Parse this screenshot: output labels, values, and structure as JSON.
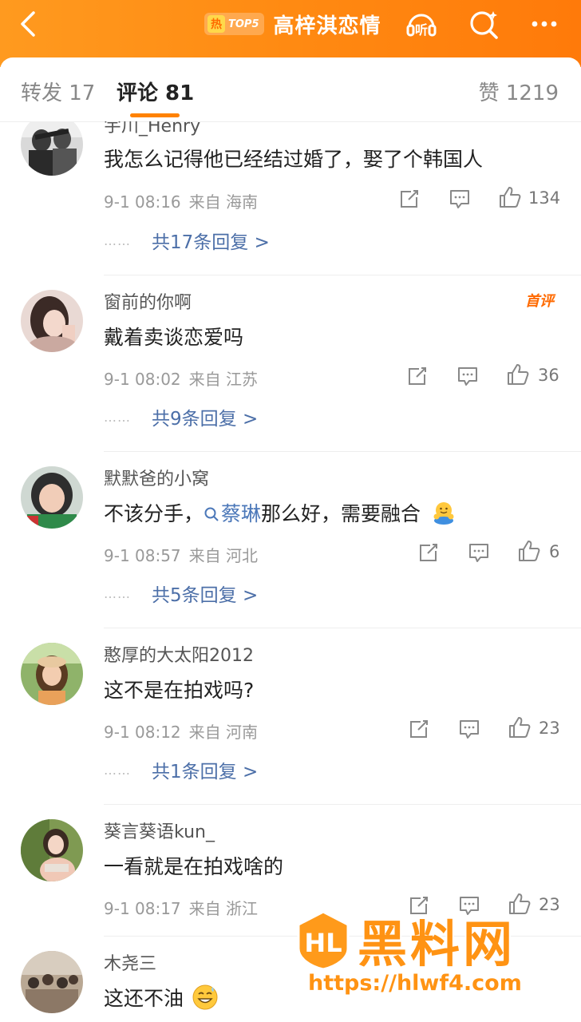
{
  "colors": {
    "accent": "#ff8200",
    "link": "#4c6fa8",
    "topbar_start": "#ff9a1f",
    "topbar_end": "#ff7a0a",
    "first_badge": "#ff6a00"
  },
  "header": {
    "hot_label": "热",
    "rank_label": "TOP5",
    "topic_title": "高梓淇恋情",
    "listen_icon_text": "听",
    "icons": [
      "back-icon",
      "listen-icon",
      "refresh-search-icon",
      "more-icon"
    ]
  },
  "tabs": {
    "repost": "转发 17",
    "comments": "评论 81",
    "likes": "赞 1219",
    "active": "comments"
  },
  "comments": [
    {
      "username": "宇川_Henry",
      "text": "我怎么记得他已经结过婚了，娶了个韩国人",
      "time": "9-1 08:16",
      "source": "来自 海南",
      "likes": "134",
      "replies": "共17条回复 >"
    },
    {
      "username": "窗前的你啊",
      "badge": "首评",
      "text": "戴着卖谈恋爱吗",
      "time": "9-1 08:02",
      "source": "来自 江苏",
      "likes": "36",
      "replies": "共9条回复 >"
    },
    {
      "username": "默默爸的小窝",
      "text_before": "不该分手，",
      "topic": "蔡琳",
      "text_after": "那么好，需要融合",
      "emoji": "hug-emoji",
      "time": "9-1 08:57",
      "source": "来自 河北",
      "likes": "6",
      "replies": "共5条回复 >"
    },
    {
      "username": "憨厚的大太阳2012",
      "text": "这不是在拍戏吗?",
      "time": "9-1 08:12",
      "source": "来自 河南",
      "likes": "23",
      "replies": "共1条回复 >"
    },
    {
      "username": "葵言葵语kun_",
      "text": "一看就是在拍戏啥的",
      "time": "9-1 08:17",
      "source": "来自 浙江",
      "likes": "23"
    },
    {
      "username": "木尧三",
      "text": "这还不油",
      "emoji": "grin-sweat-emoji"
    }
  ],
  "watermark": {
    "title": "黑料网",
    "url": "https://hlwf4.com"
  }
}
